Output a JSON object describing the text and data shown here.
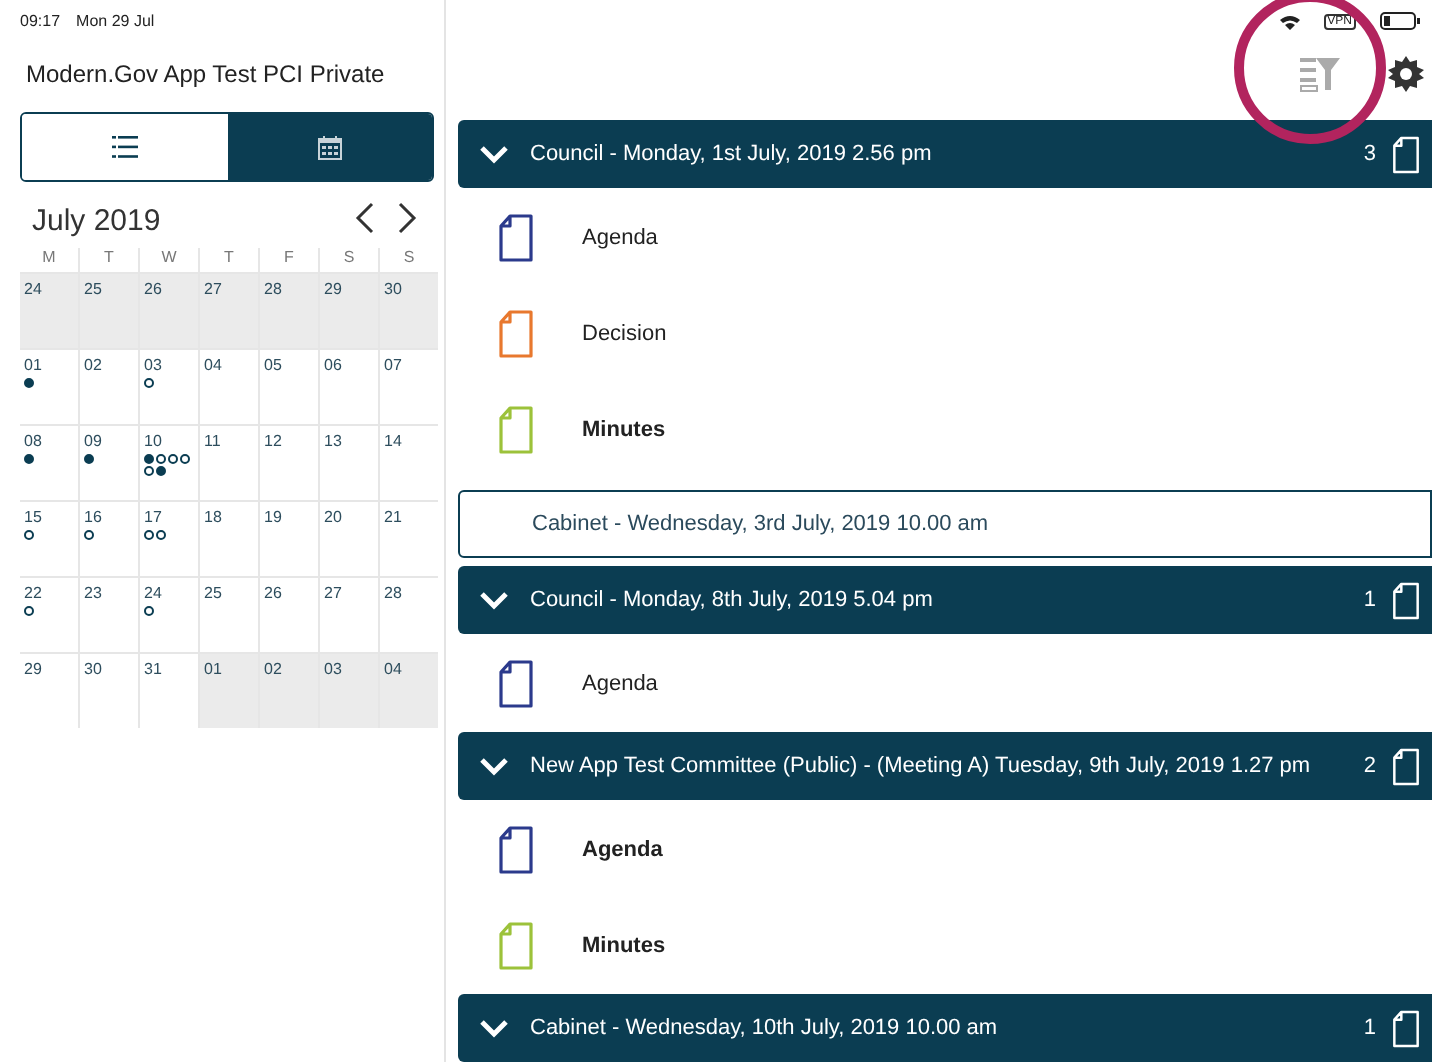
{
  "status_bar": {
    "time": "09:17",
    "date": "Mon 29 Jul",
    "vpn": "VPN"
  },
  "app_title": "Modern.Gov App Test PCI Private",
  "view_tabs": [
    {
      "kind": "list",
      "selected": false
    },
    {
      "kind": "calendar",
      "selected": true
    }
  ],
  "calendar": {
    "month": "July 2019",
    "weekdays": [
      "M",
      "T",
      "W",
      "T",
      "F",
      "S",
      "S"
    ],
    "weeks": [
      [
        {
          "day": "24",
          "outside": true
        },
        {
          "day": "25",
          "outside": true
        },
        {
          "day": "26",
          "outside": true
        },
        {
          "day": "27",
          "outside": true
        },
        {
          "day": "28",
          "outside": true
        },
        {
          "day": "29",
          "outside": true
        },
        {
          "day": "30",
          "outside": true
        }
      ],
      [
        {
          "day": "01",
          "outside": false,
          "dots": [
            {
              "filled": true
            }
          ]
        },
        {
          "day": "02",
          "outside": false
        },
        {
          "day": "03",
          "outside": false,
          "dots": [
            {
              "filled": false
            }
          ]
        },
        {
          "day": "04",
          "outside": false
        },
        {
          "day": "05",
          "outside": false
        },
        {
          "day": "06",
          "outside": false
        },
        {
          "day": "07",
          "outside": false
        }
      ],
      [
        {
          "day": "08",
          "outside": false,
          "dots": [
            {
              "filled": true
            }
          ]
        },
        {
          "day": "09",
          "outside": false,
          "dots": [
            {
              "filled": true
            }
          ]
        },
        {
          "day": "10",
          "outside": false,
          "dots": [
            {
              "filled": true
            },
            {
              "filled": false
            },
            {
              "filled": false
            },
            {
              "filled": false
            },
            {
              "filled": false
            },
            {
              "filled": true
            }
          ]
        },
        {
          "day": "11",
          "outside": false
        },
        {
          "day": "12",
          "outside": false
        },
        {
          "day": "13",
          "outside": false
        },
        {
          "day": "14",
          "outside": false
        }
      ],
      [
        {
          "day": "15",
          "outside": false,
          "dots": [
            {
              "filled": false
            }
          ]
        },
        {
          "day": "16",
          "outside": false,
          "dots": [
            {
              "filled": false
            }
          ]
        },
        {
          "day": "17",
          "outside": false,
          "dots": [
            {
              "filled": false
            },
            {
              "filled": false
            }
          ]
        },
        {
          "day": "18",
          "outside": false
        },
        {
          "day": "19",
          "outside": false
        },
        {
          "day": "20",
          "outside": false
        },
        {
          "day": "21",
          "outside": false
        }
      ],
      [
        {
          "day": "22",
          "outside": false,
          "dots": [
            {
              "filled": false
            }
          ]
        },
        {
          "day": "23",
          "outside": false
        },
        {
          "day": "24",
          "outside": false,
          "dots": [
            {
              "filled": false
            }
          ]
        },
        {
          "day": "25",
          "outside": false
        },
        {
          "day": "26",
          "outside": false
        },
        {
          "day": "27",
          "outside": false
        },
        {
          "day": "28",
          "outside": false
        }
      ],
      [
        {
          "day": "29",
          "outside": false
        },
        {
          "day": "30",
          "outside": false
        },
        {
          "day": "31",
          "outside": false
        },
        {
          "day": "01",
          "outside": true
        },
        {
          "day": "02",
          "outside": true
        },
        {
          "day": "03",
          "outside": true
        },
        {
          "day": "04",
          "outside": true
        }
      ]
    ]
  },
  "meetings": [
    {
      "title": "Council - Monday, 1st July, 2019 2.56 pm",
      "expanded": true,
      "count": "3",
      "documents": [
        {
          "name": "Agenda",
          "color": "#2b3a8c",
          "bold": false
        },
        {
          "name": "Decision",
          "color": "#e8782e",
          "bold": false
        },
        {
          "name": "Minutes",
          "color": "#9cc23a",
          "bold": true
        }
      ]
    },
    {
      "title": "Cabinet - Wednesday, 3rd July, 2019 10.00 am",
      "expanded": false
    },
    {
      "title": "Council - Monday, 8th July, 2019 5.04 pm",
      "expanded": true,
      "count": "1",
      "documents": [
        {
          "name": "Agenda",
          "color": "#2b3a8c",
          "bold": false
        }
      ]
    },
    {
      "title": "New App Test Committee (Public) - (Meeting A) Tuesday, 9th July, 2019 1.27 pm",
      "expanded": true,
      "count": "2",
      "documents": [
        {
          "name": "Agenda",
          "color": "#2b3a8c",
          "bold": true
        },
        {
          "name": "Minutes",
          "color": "#9cc23a",
          "bold": true
        }
      ]
    },
    {
      "title": "Cabinet - Wednesday, 10th July, 2019 10.00 am",
      "expanded": true,
      "count": "1"
    }
  ]
}
